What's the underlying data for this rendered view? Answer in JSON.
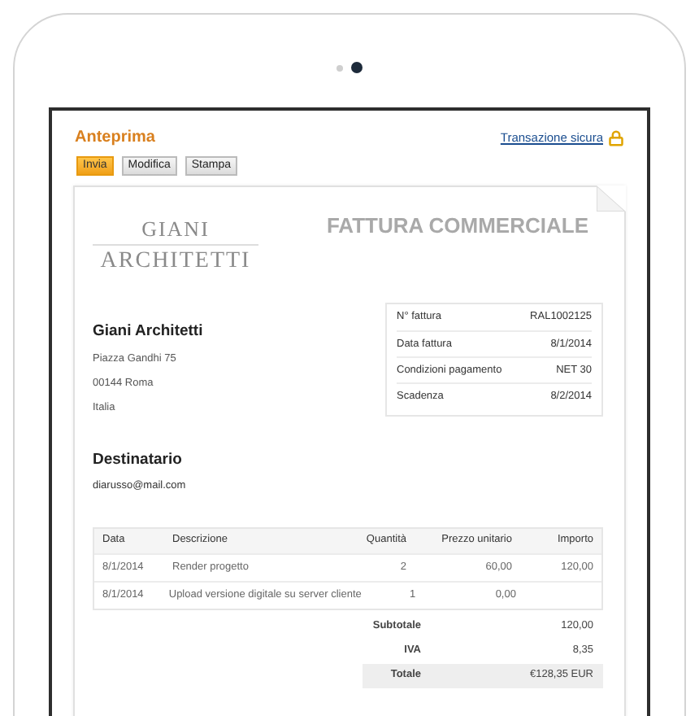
{
  "header": {
    "title": "Anteprima",
    "secure_link": "Transazione sicura"
  },
  "buttons": [
    {
      "label": "Invia",
      "primary": true
    },
    {
      "label": "Modifica",
      "primary": false
    },
    {
      "label": "Stampa",
      "primary": false
    }
  ],
  "invoice": {
    "logo": [
      "GIANI",
      "ARCHITETTI"
    ],
    "title": "FATTURA COMMERCIALE",
    "sender": {
      "name": "Giani Architetti",
      "lines": [
        "Piazza Gandhi 75",
        "00144 Roma",
        "Italia"
      ]
    },
    "details": [
      {
        "label": "N° fattura",
        "value": "RAL1002125"
      },
      {
        "label": "Data fattura",
        "value": "8/1/2014"
      },
      {
        "label": "Condizioni pagamento",
        "value": "NET 30"
      },
      {
        "label": "Scadenza",
        "value": "8/2/2014"
      }
    ],
    "recipient": {
      "title": "Destinatario",
      "email": "diarusso@mail.com"
    },
    "table": {
      "columns": [
        "Data",
        "Descrizione",
        "Quantità",
        "Prezzo unitario",
        "Importo"
      ],
      "rows": [
        [
          "8/1/2014",
          "Render progetto",
          "2",
          "60,00",
          "120,00"
        ],
        [
          "8/1/2014",
          "Upload versione digitale su server cliente",
          "1",
          "0,00"
        ]
      ]
    },
    "totals": [
      {
        "label": "Subtotale",
        "value": "120,00",
        "highlight": false
      },
      {
        "label": "IVA",
        "value": "8,35",
        "highlight": false
      },
      {
        "label": "Totale",
        "value": "€128,35 EUR",
        "highlight": true
      }
    ]
  }
}
